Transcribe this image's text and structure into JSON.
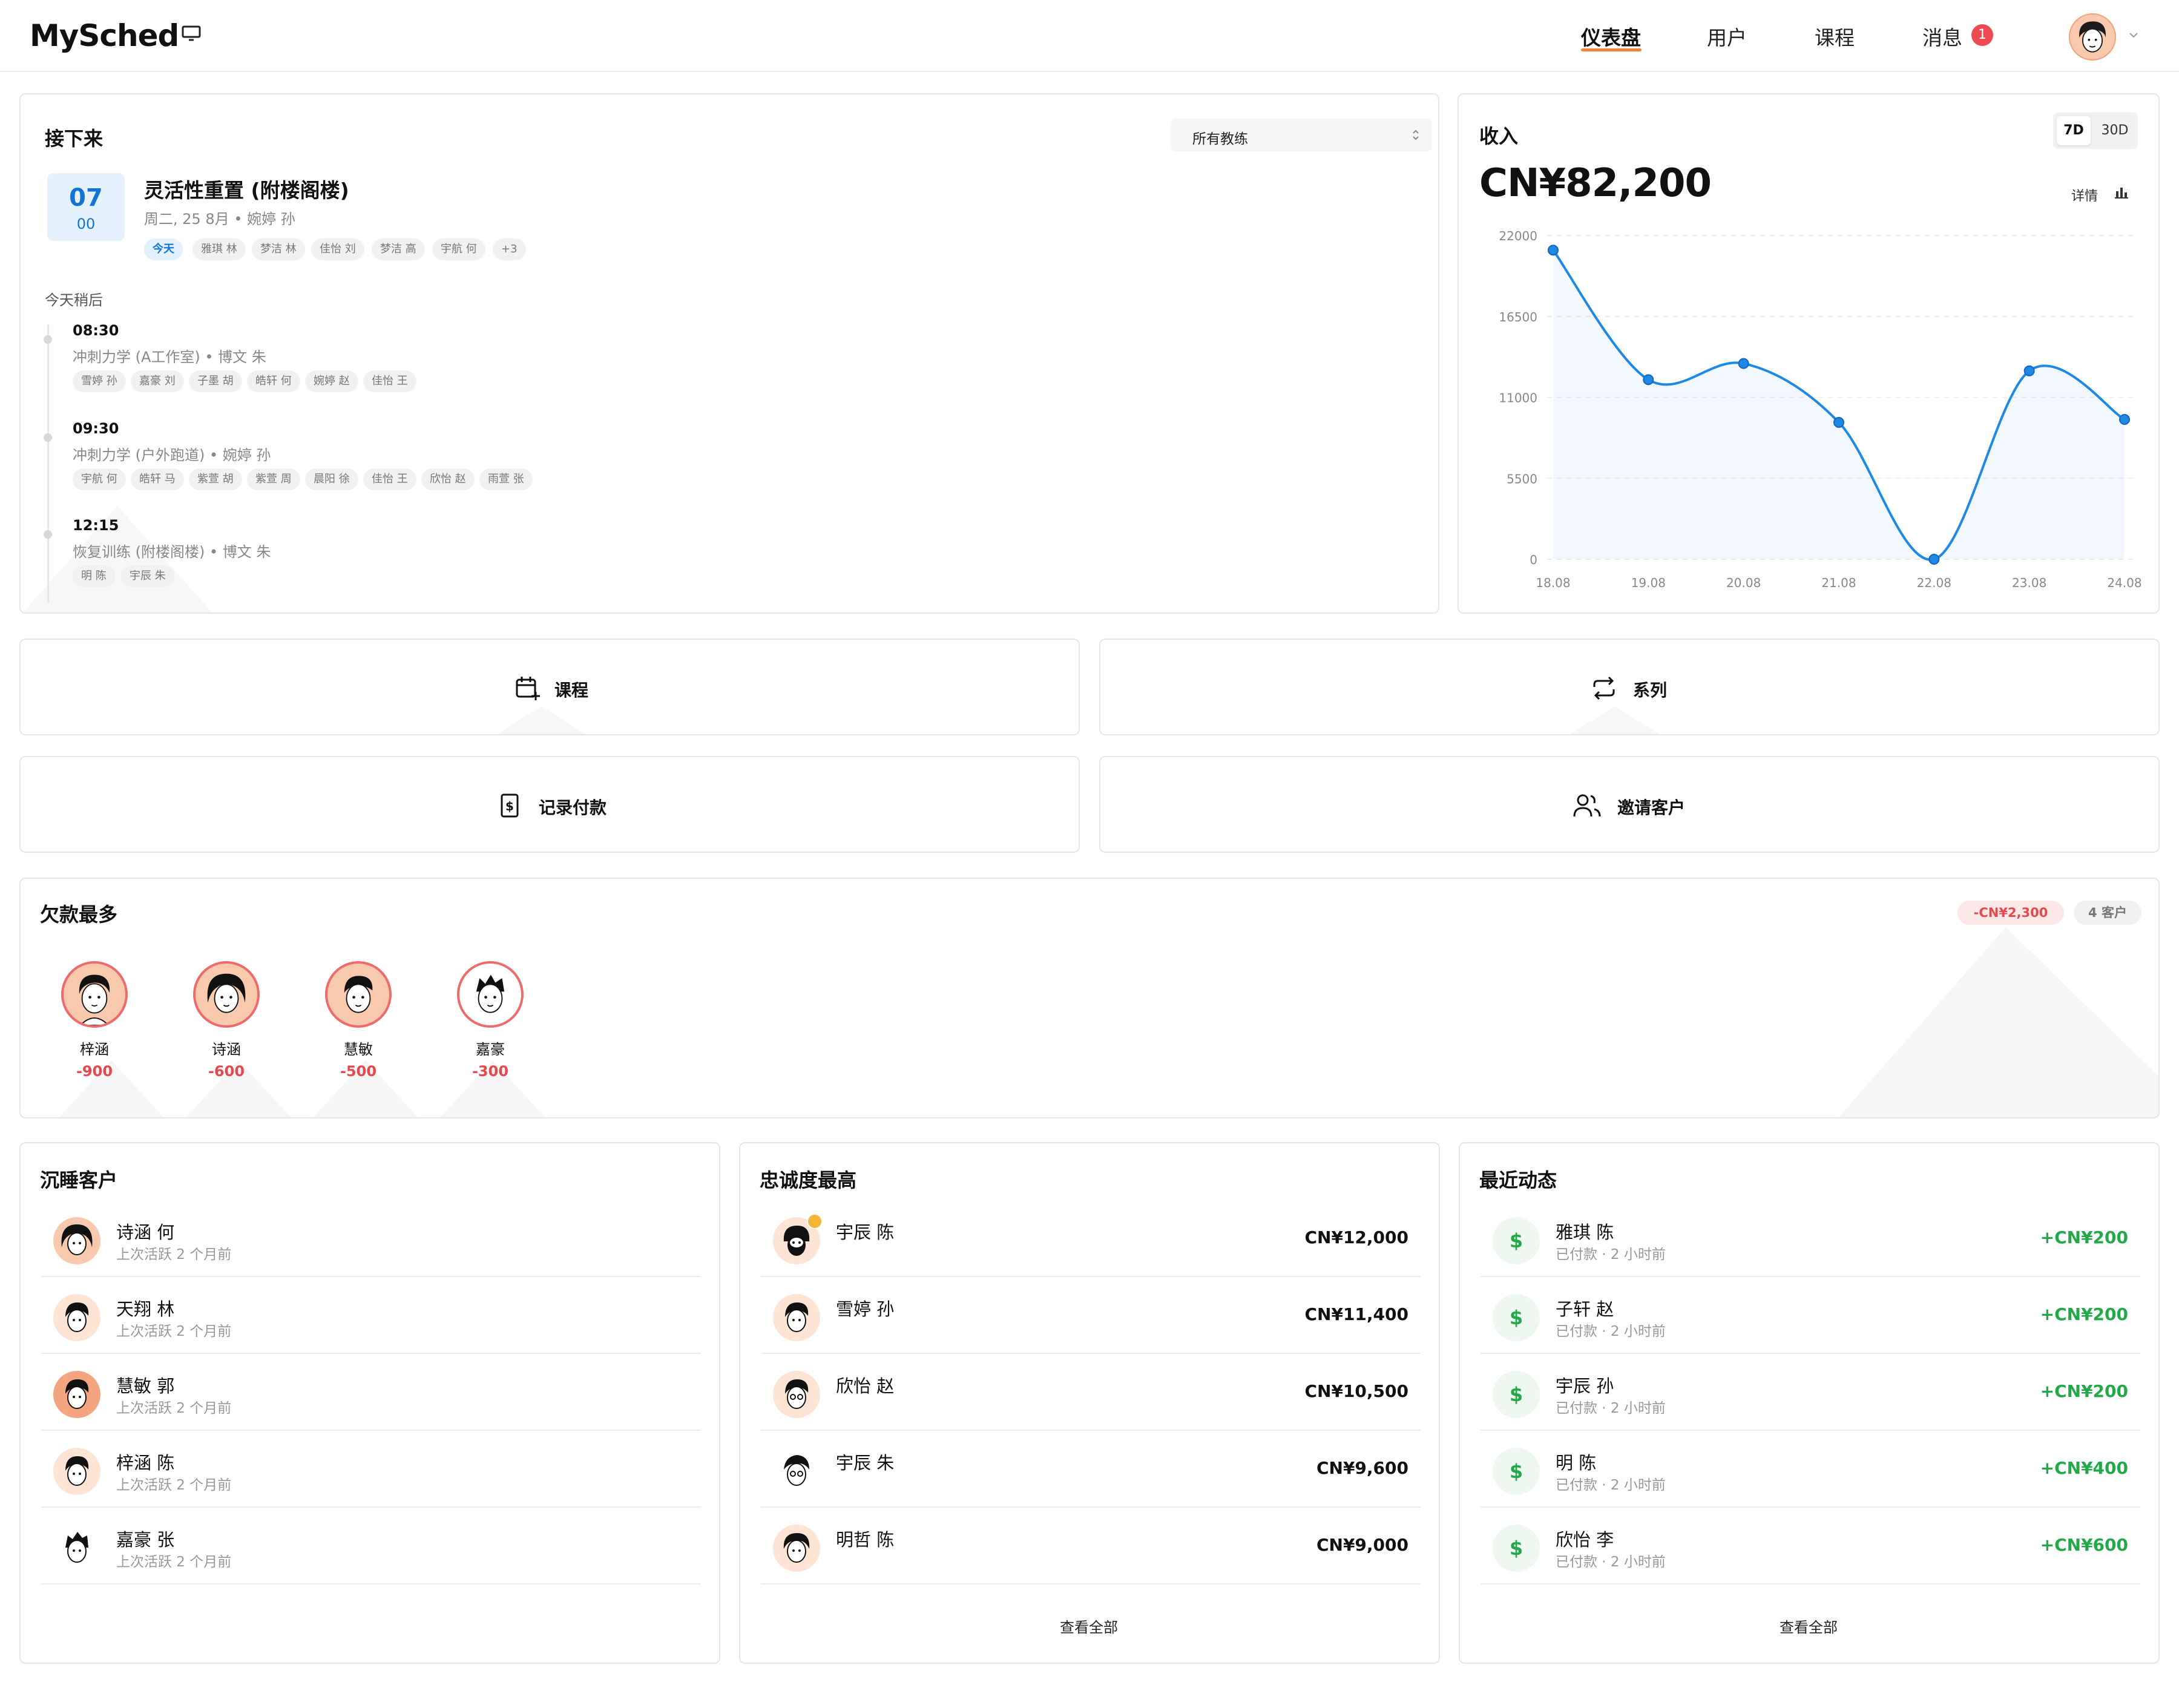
{
  "header": {
    "logo": "MySched",
    "nav": [
      {
        "label": "仪表盘"
      },
      {
        "label": "用户"
      },
      {
        "label": "课程"
      },
      {
        "label": "消息"
      }
    ],
    "messages_badge": "1"
  },
  "upcoming": {
    "title": "接下来",
    "filter": "所有教练",
    "next": {
      "day": "07",
      "hour": "00",
      "title": "灵活性重置 (附楼阁楼)",
      "sub": "周二, 25 8月 • 婉婷 孙",
      "chips": [
        "今天",
        "雅琪 林",
        "梦洁 林",
        "佳怡 刘",
        "梦洁 高",
        "宇航 何",
        "+3"
      ]
    },
    "later_label": "今天稍后",
    "later": [
      {
        "time": "08:30",
        "title": "冲刺力学 (A工作室) • 博文 朱",
        "chips": [
          "雪婷 孙",
          "嘉豪 刘",
          "子墨 胡",
          "皓轩 何",
          "婉婷 赵",
          "佳怡 王"
        ]
      },
      {
        "time": "09:30",
        "title": "冲刺力学 (户外跑道) • 婉婷 孙",
        "chips": [
          "宇航 何",
          "皓轩 马",
          "紫萱 胡",
          "紫萱 周",
          "晨阳 徐",
          "佳怡 王",
          "欣怡 赵",
          "雨萱 张"
        ]
      },
      {
        "time": "12:15",
        "title": "恢复训练 (附楼阁楼) • 博文 朱",
        "chips": [
          "明 陈",
          "宇辰 朱"
        ]
      }
    ]
  },
  "revenue": {
    "title": "收入",
    "range_7d": "7D",
    "range_30d": "30D",
    "amount": "CN¥82,200",
    "detail": "详情",
    "chart_data": {
      "type": "area",
      "x": [
        "18.08",
        "19.08",
        "20.08",
        "21.08",
        "22.08",
        "23.08",
        "24.08"
      ],
      "values": [
        21000,
        12200,
        13300,
        9300,
        0,
        12800,
        9500
      ],
      "yticks": [
        "22000",
        "16500",
        "11000",
        "5500",
        "0"
      ],
      "ylim": [
        0,
        22000
      ],
      "color": "#1e88e5"
    }
  },
  "actions": {
    "lesson": "课程",
    "series": "系列",
    "record_payment": "记录付款",
    "invite_client": "邀请客户"
  },
  "owing": {
    "title": "欠款最多",
    "total": "-CN¥2,300",
    "clients": "4 客户",
    "people": [
      {
        "name": "梓涵",
        "amount": "-900"
      },
      {
        "name": "诗涵",
        "amount": "-600"
      },
      {
        "name": "慧敏",
        "amount": "-500"
      },
      {
        "name": "嘉豪",
        "amount": "-300"
      }
    ]
  },
  "dormant": {
    "title": "沉睡客户",
    "items": [
      {
        "name": "诗涵 何",
        "sub": "上次活跃 2 个月前"
      },
      {
        "name": "天翔 林",
        "sub": "上次活跃 2 个月前"
      },
      {
        "name": "慧敏 郭",
        "sub": "上次活跃 2 个月前"
      },
      {
        "name": "梓涵 陈",
        "sub": "上次活跃 2 个月前"
      },
      {
        "name": "嘉豪 张",
        "sub": "上次活跃 2 个月前"
      }
    ]
  },
  "loyal": {
    "title": "忠诚度最高",
    "view_all": "查看全部",
    "items": [
      {
        "name": "宇辰 陈",
        "value": "CN¥12,000"
      },
      {
        "name": "雪婷 孙",
        "value": "CN¥11,400"
      },
      {
        "name": "欣怡 赵",
        "value": "CN¥10,500"
      },
      {
        "name": "宇辰 朱",
        "value": "CN¥9,600"
      },
      {
        "name": "明哲 陈",
        "value": "CN¥9,000"
      }
    ]
  },
  "activity": {
    "title": "最近动态",
    "view_all": "查看全部",
    "icon": "$",
    "items": [
      {
        "name": "雅琪 陈",
        "sub": "已付款 · 2 小时前",
        "value": "+CN¥200"
      },
      {
        "name": "子轩 赵",
        "sub": "已付款 · 2 小时前",
        "value": "+CN¥200"
      },
      {
        "name": "宇辰 孙",
        "sub": "已付款 · 2 小时前",
        "value": "+CN¥200"
      },
      {
        "name": "明 陈",
        "sub": "已付款 · 2 小时前",
        "value": "+CN¥400"
      },
      {
        "name": "欣怡 李",
        "sub": "已付款 · 2 小时前",
        "value": "+CN¥600"
      }
    ]
  }
}
